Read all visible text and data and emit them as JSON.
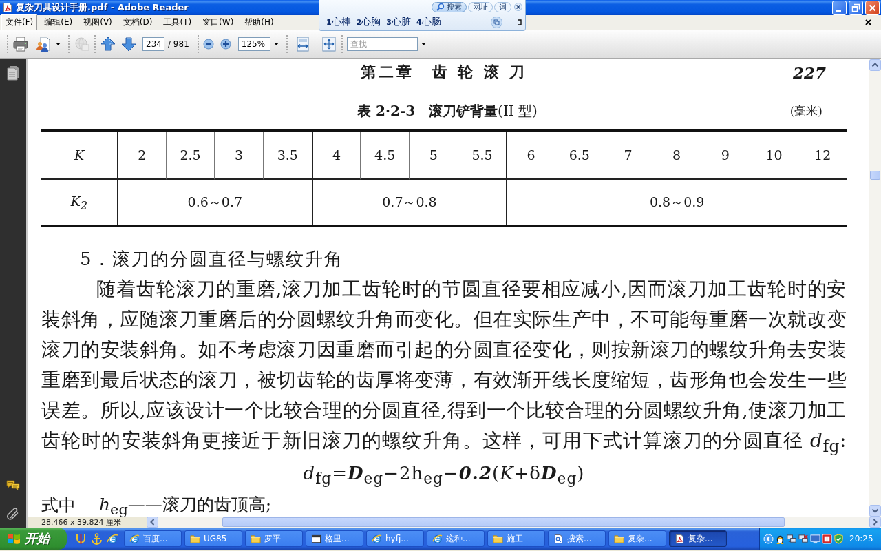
{
  "window": {
    "title": "复杂刀具设计手册.pdf - Adobe Reader"
  },
  "search_bar": {
    "tabs": [
      {
        "label": "搜索",
        "selected": true
      },
      {
        "label": "网址",
        "selected": false
      },
      {
        "label": "词",
        "selected": false
      }
    ],
    "suggestions": [
      {
        "index": "1",
        "text": "心棒"
      },
      {
        "index": "2",
        "text": "心胸"
      },
      {
        "index": "3",
        "text": "心脏"
      },
      {
        "index": "4",
        "text": "心肠"
      }
    ]
  },
  "menu": {
    "items": [
      {
        "label": "文件(F)",
        "selected": true
      },
      {
        "label": "编辑(E)",
        "selected": false
      },
      {
        "label": "视图(V)",
        "selected": false
      },
      {
        "label": "文档(D)",
        "selected": false
      },
      {
        "label": "工具(T)",
        "selected": false
      },
      {
        "label": "窗口(W)",
        "selected": false
      },
      {
        "label": "帮助(H)",
        "selected": false
      }
    ]
  },
  "toolbar": {
    "page": "234",
    "page_count": "/ 981",
    "zoom": "125%",
    "find_placeholder": "查找"
  },
  "document": {
    "chapter_title": "第二章　齿 轮 滚 刀",
    "page_number": "227",
    "table_caption": "**表 2·2-3　滚刀铲背量**(II 型)",
    "unit": "(毫米)",
    "table": {
      "row_headers": [
        "K",
        "K$_{2}$"
      ],
      "groups": [
        {
          "k_values": [
            "2",
            "2.5",
            "3",
            "3.5"
          ],
          "k2_range": "0.6～0.7"
        },
        {
          "k_values": [
            "4",
            "4.5",
            "5",
            "5.5"
          ],
          "k2_range": "0.7～0.8"
        },
        {
          "k_values": [
            "6",
            "6.5",
            "7",
            "8",
            "9",
            "10",
            "12"
          ],
          "k2_range": "0.8～0.9"
        }
      ]
    },
    "section_heading": "5．滚刀的分圆直径与螺纹升角",
    "paragraph": "随着齿轮滚刀的重磨,滚刀加工齿轮时的节圆直径要相应减小,因而滚刀加工齿轮时的安装斜角，应随滚刀重磨后的分圆螺纹升角而变化。但在实际生产中，不可能每重磨一次就改变滚刀的安装斜角。如不考虑滚刀因重磨而引起的分圆直径变化，则按新滚刀的螺纹升角去安装重磨到最后状态的滚刀，被切齿轮的齿厚将变薄，有效渐开线长度缩短，齿形角也会发生一些误差。所以,应该设计一个比较合理的分圆直径,得到一个比较合理的分圆螺纹升角,使滚刀加工齿轮时的安装斜角更接近于新旧滚刀的螺纹升角。这样，可用下式计算滚刀的分圆直径 *d*$_{fg}$:",
    "formula": "*d*$_{fg}$=**D**$_{eg}$−2h$_{eg}$−**0.2**(*K*+δ**D**$_{eg}$)",
    "definition": {
      "term": "式中",
      "text": "*h*$_{eg}$——滚刀的齿顶高;"
    }
  },
  "status_bar": {
    "page_size": "28.466 x 39.824 厘米"
  },
  "taskbar": {
    "start": "开始",
    "tasks": [
      {
        "label": "百度...",
        "kind": "browser",
        "selected": false
      },
      {
        "label": "UG85",
        "kind": "folder",
        "selected": false
      },
      {
        "label": "罗平",
        "kind": "folder",
        "selected": false
      },
      {
        "label": "格里...",
        "kind": "window",
        "selected": false
      },
      {
        "label": "hyfj...",
        "kind": "browser",
        "selected": false
      },
      {
        "label": "这种...",
        "kind": "browser",
        "selected": false
      },
      {
        "label": "施工",
        "kind": "folder",
        "selected": false
      },
      {
        "label": "搜索...",
        "kind": "document",
        "selected": false
      },
      {
        "label": "复杂...",
        "kind": "folder",
        "selected": false
      },
      {
        "label": "复杂...",
        "kind": "pdf",
        "selected": true
      }
    ],
    "clock": "20:25"
  }
}
